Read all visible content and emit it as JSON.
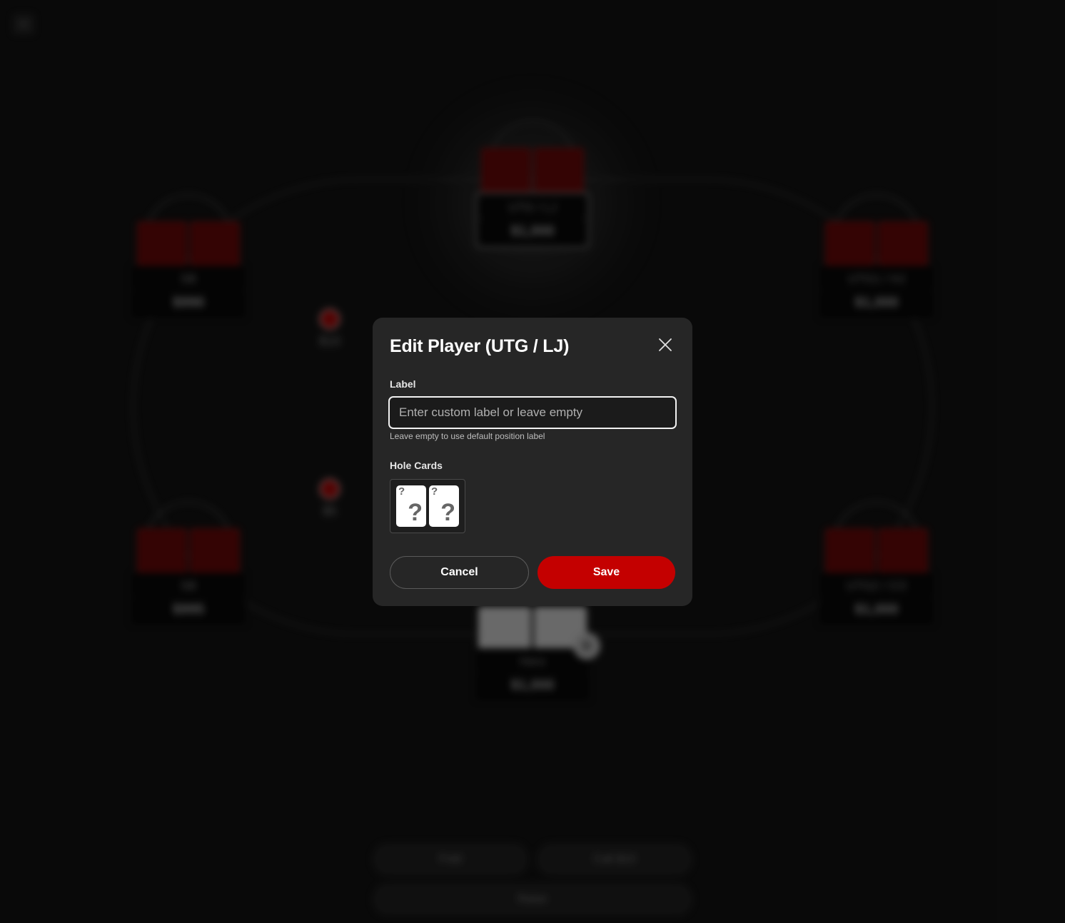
{
  "table": {
    "corner_icon": "close-icon",
    "seats": [
      {
        "position": "UTG / LJ",
        "stack": "$1,000",
        "active": true
      },
      {
        "position": "SB",
        "stack": "$990",
        "active": false
      },
      {
        "position": "UTG1 / HJ",
        "stack": "$1,000",
        "active": false
      },
      {
        "position": "SB",
        "stack": "$995",
        "active": false
      },
      {
        "position": "UTG2 / CO",
        "stack": "$1,000",
        "active": false
      },
      {
        "position": "Hero",
        "stack": "$1,000",
        "active": false
      }
    ],
    "bets": [
      {
        "amount": "$10"
      },
      {
        "amount": "$5"
      }
    ],
    "dealer_button": "D",
    "actions": {
      "fold": "Fold",
      "call": "Call $10",
      "raise": "Raise"
    }
  },
  "modal": {
    "title": "Edit Player (UTG / LJ)",
    "label_field": {
      "label": "Label",
      "value": "",
      "placeholder": "Enter custom label or leave empty",
      "hint": "Leave empty to use default position label"
    },
    "hole_cards": {
      "label": "Hole Cards",
      "cards": [
        {
          "corner": "?",
          "center": "?"
        },
        {
          "corner": "?",
          "center": "?"
        }
      ]
    },
    "cancel_label": "Cancel",
    "save_label": "Save",
    "colors": {
      "modal_bg": "#262626",
      "save_bg": "#c40000",
      "card_back": "#6d0000"
    }
  }
}
